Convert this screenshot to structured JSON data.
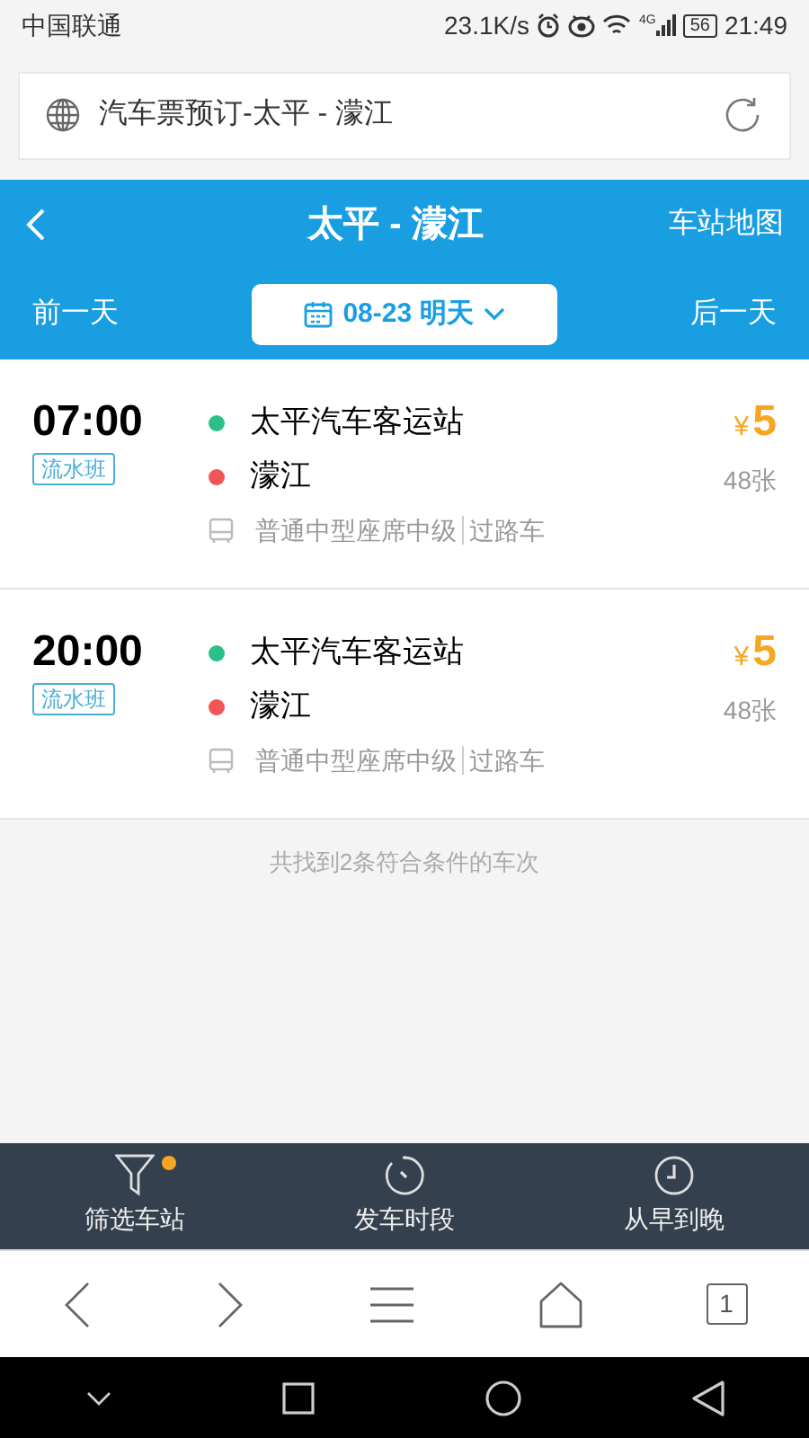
{
  "status_bar": {
    "carrier": "中国联通",
    "speed": "23.1K/s",
    "network": "4G",
    "battery": "56",
    "time": "21:49"
  },
  "address_bar": {
    "title": "汽车票预订-太平 - 濛江"
  },
  "header": {
    "title": "太平 - 濛江",
    "map_link": "车站地图",
    "prev_day": "前一天",
    "date": "08-23 明天",
    "next_day": "后一天"
  },
  "trips": [
    {
      "time": "07:00",
      "tag": "流水班",
      "stops": [
        {
          "name": "太平汽车客运站",
          "color": "#2bbf8a"
        },
        {
          "name": "濛江",
          "color": "#f25555"
        }
      ],
      "info": "普通中型座席中级",
      "route": "过路车",
      "currency": "¥",
      "price": "5",
      "seats": "48张"
    },
    {
      "time": "20:00",
      "tag": "流水班",
      "stops": [
        {
          "name": "太平汽车客运站",
          "color": "#2bbf8a"
        },
        {
          "name": "濛江",
          "color": "#f25555"
        }
      ],
      "info": "普通中型座席中级",
      "route": "过路车",
      "currency": "¥",
      "price": "5",
      "seats": "48张"
    }
  ],
  "result_note": "共找到2条符合条件的车次",
  "toolbar": [
    {
      "kind": "filter",
      "label": "筛选车站",
      "dot": true
    },
    {
      "kind": "period",
      "label": "发车时段",
      "dot": false
    },
    {
      "kind": "order",
      "label": "从早到晚",
      "dot": false
    }
  ],
  "browser_bar": {
    "tab_count": "1"
  }
}
